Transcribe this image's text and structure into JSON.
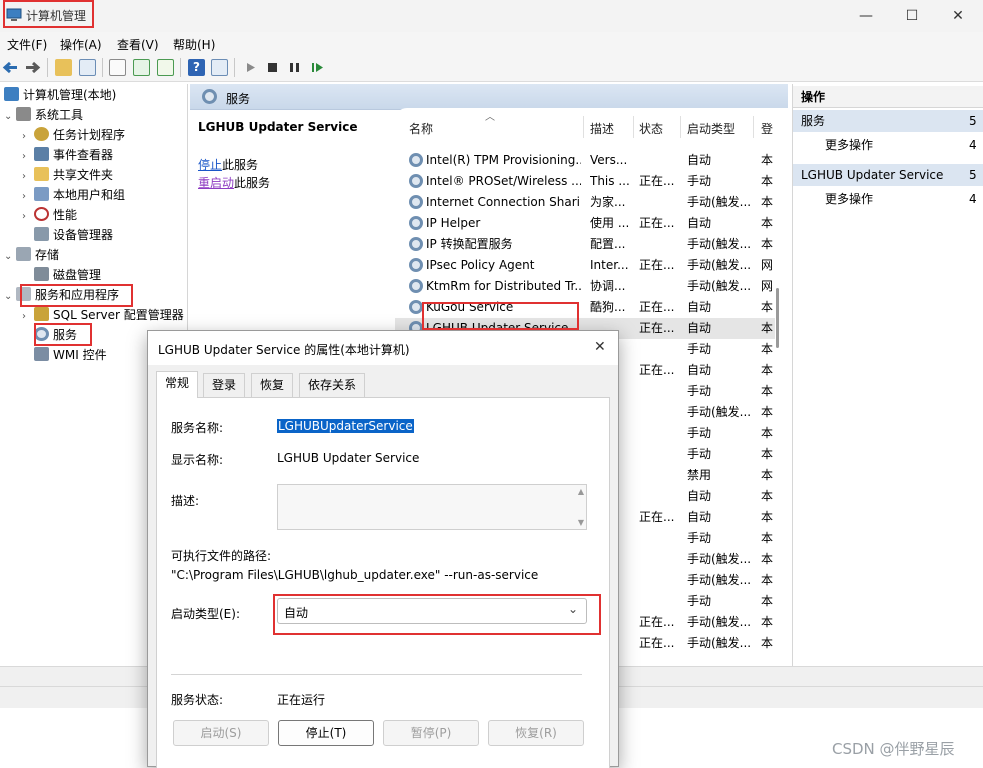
{
  "window": {
    "title": "计算机管理",
    "min": "—",
    "max": "☐",
    "close": "✕"
  },
  "menu": [
    "文件(F)",
    "操作(A)",
    "查看(V)",
    "帮助(H)"
  ],
  "tree": {
    "root": "计算机管理(本地)",
    "system_tools": "系统工具",
    "task_scheduler": "任务计划程序",
    "event_viewer": "事件查看器",
    "shared_folders": "共享文件夹",
    "local_users": "本地用户和组",
    "performance": "性能",
    "device_manager": "设备管理器",
    "storage": "存储",
    "disk_mgmt": "磁盘管理",
    "services_apps": "服务和应用程序",
    "sql_config": "SQL Server 配置管理器",
    "services": "服务",
    "wmi": "WMI 控件"
  },
  "center": {
    "header": "服务",
    "selected_name": "LGHUB Updater Service",
    "stop_link": "停止",
    "stop_suffix": "此服务",
    "restart_link": "重启动",
    "restart_suffix": "此服务"
  },
  "columns": {
    "name": "名称",
    "desc": "描述",
    "status": "状态",
    "startup": "启动类型",
    "logon": "登"
  },
  "rows": [
    {
      "name": "Intel(R) TPM Provisioning...",
      "desc": "Vers...",
      "status": "",
      "startup": "自动",
      "logon": "本"
    },
    {
      "name": "Intel® PROSet/Wireless ...",
      "desc": "This ...",
      "status": "正在...",
      "startup": "手动",
      "logon": "本"
    },
    {
      "name": "Internet Connection Shari...",
      "desc": "为家...",
      "status": "",
      "startup": "手动(触发...",
      "logon": "本"
    },
    {
      "name": "IP Helper",
      "desc": "使用 ...",
      "status": "正在...",
      "startup": "自动",
      "logon": "本"
    },
    {
      "name": "IP 转换配置服务",
      "desc": "配置...",
      "status": "",
      "startup": "手动(触发...",
      "logon": "本"
    },
    {
      "name": "IPsec Policy Agent",
      "desc": "Inter...",
      "status": "正在...",
      "startup": "手动(触发...",
      "logon": "网"
    },
    {
      "name": "KtmRm for Distributed Tr...",
      "desc": "协调...",
      "status": "",
      "startup": "手动(触发...",
      "logon": "网"
    },
    {
      "name": "KuGou Service",
      "desc": "酷狗...",
      "status": "正在...",
      "startup": "自动",
      "logon": "本"
    },
    {
      "name": "LGHUB Updater Service",
      "desc": "",
      "status": "正在...",
      "startup": "自动",
      "logon": "本"
    },
    {
      "name": "",
      "desc": "",
      "status": "",
      "startup": "手动",
      "logon": "本"
    },
    {
      "name": "",
      "desc": "",
      "status": "正在...",
      "startup": "自动",
      "logon": "本"
    },
    {
      "name": "",
      "desc": "",
      "status": "",
      "startup": "手动",
      "logon": "本"
    },
    {
      "name": "",
      "desc": "",
      "status": "",
      "startup": "手动(触发...",
      "logon": "本"
    },
    {
      "name": "",
      "desc": "",
      "status": "",
      "startup": "手动",
      "logon": "本"
    },
    {
      "name": "",
      "desc": "",
      "status": "",
      "startup": "手动",
      "logon": "本"
    },
    {
      "name": "",
      "desc": "",
      "status": "",
      "startup": "禁用",
      "logon": "本"
    },
    {
      "name": "",
      "desc": "",
      "status": "",
      "startup": "自动",
      "logon": "本"
    },
    {
      "name": "",
      "desc": "",
      "status": "正在...",
      "startup": "自动",
      "logon": "本"
    },
    {
      "name": "",
      "desc": "",
      "status": "",
      "startup": "手动",
      "logon": "本"
    },
    {
      "name": "",
      "desc": "",
      "status": "",
      "startup": "手动(触发...",
      "logon": "本"
    },
    {
      "name": "",
      "desc": "",
      "status": "",
      "startup": "手动(触发...",
      "logon": "本"
    },
    {
      "name": "",
      "desc": "",
      "status": "",
      "startup": "手动",
      "logon": "本"
    },
    {
      "name": "",
      "desc": "",
      "status": "正在...",
      "startup": "手动(触发...",
      "logon": "本"
    },
    {
      "name": "",
      "desc": "",
      "status": "正在...",
      "startup": "手动(触发...",
      "logon": "本"
    }
  ],
  "actions": {
    "title": "操作",
    "sec1": "服务",
    "sec1_count": "5",
    "more1": "更多操作",
    "more1_count": "4",
    "sec2": "LGHUB Updater Service",
    "sec2_count": "5",
    "more2": "更多操作",
    "more2_count": "4"
  },
  "dialog": {
    "title": "LGHUB Updater Service 的属性(本地计算机)",
    "tabs": [
      "常规",
      "登录",
      "恢复",
      "依存关系"
    ],
    "service_name_label": "服务名称:",
    "service_name": "LGHUBUpdaterService",
    "display_name_label": "显示名称:",
    "display_name": "LGHUB Updater Service",
    "desc_label": "描述:",
    "path_label": "可执行文件的路径:",
    "path": "\"C:\\Program Files\\LGHUB\\lghub_updater.exe\" --run-as-service",
    "startup_label": "启动类型(E):",
    "startup_value": "自动",
    "status_label": "服务状态:",
    "status_value": "正在运行",
    "buttons": {
      "start": "启动(S)",
      "stop": "停止(T)",
      "pause": "暂停(P)",
      "resume": "恢复(R)"
    }
  },
  "watermark": "CSDN @伴野星辰",
  "colors": {
    "highlight": "#e03131",
    "section_blue": "#dbe5f1",
    "link": "#1a56c8"
  }
}
